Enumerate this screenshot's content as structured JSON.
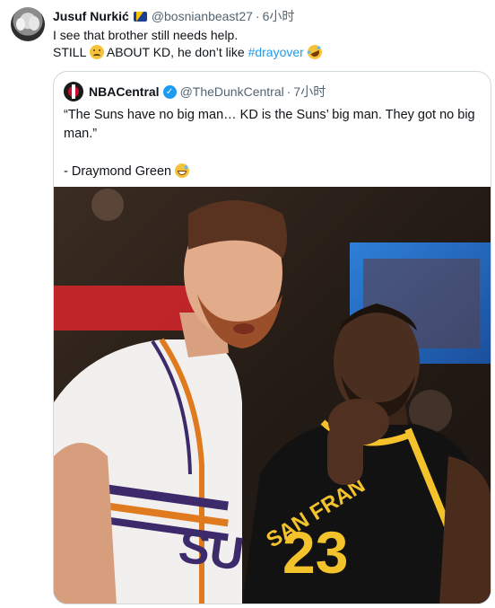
{
  "tweet": {
    "author_name": "Jusuf Nurkić",
    "author_handle": "@bosnianbeast27",
    "separator": "·",
    "time": "6小时",
    "line1": "I see that brother still needs help.",
    "line2_prefix": "STILL",
    "line2_middle": "ABOUT KD, he don’t like",
    "hashtag": "#drayover",
    "emojis": [
      "sad-face-emoji",
      "rolling-laughing-emoji"
    ]
  },
  "quoted": {
    "author_name": "NBACentral",
    "author_handle": "@TheDunkCentral",
    "separator": "·",
    "time": "7小时",
    "quote_text": "“The Suns have no big man… KD is the Suns’ big man. They got no big man.”",
    "attribution": "- Draymond Green",
    "emoji": "grinning-sweat-emoji",
    "photo": {
      "left_jersey_text": "SUNS",
      "right_jersey_text": "SAN FRAN",
      "right_jersey_number": "23"
    },
    "colors": {
      "link": "#1d9bf0",
      "verified": "#1d9bf0",
      "border": "#cfd9de"
    }
  }
}
